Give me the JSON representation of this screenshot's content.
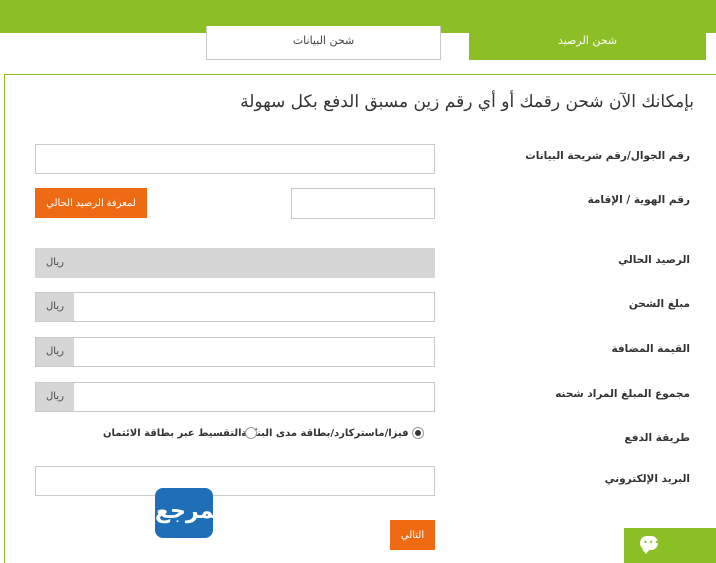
{
  "tabs": {
    "data_recharge": "شحن البيانات",
    "balance_recharge": "شحن الرصيد"
  },
  "headline": "بإمكانك الآن شحن رقمك أو أي رقم زين مسبق الدفع بكل سهولة",
  "form": {
    "mobile_label": "رقم الجوال/رقم شريحة البيانات",
    "mobile_value": "",
    "id_label": "رقم الهوية / الإقامة",
    "id_value": "",
    "check_balance_button": "لمعرفة الرصيد الحالي",
    "current_balance_label": "الرصيد الحالي",
    "amount_label": "مبلغ الشحن",
    "vat_label": "القيمة المضافة",
    "total_label": "مجموع المبلغ المراد شحنه",
    "currency": "ريال",
    "payment_label": "طريقة الدفع",
    "payment_options": [
      {
        "label": "فيزا/ماستركارد/بطاقة مدى البنكية",
        "selected": true
      },
      {
        "label": "التقسيط عبر بطاقة الائتمان",
        "selected": false
      }
    ],
    "email_label": "البريد الإلكتروني",
    "email_value": "",
    "next_button": "التالي"
  },
  "logo_text": "المرجع",
  "colors": {
    "brand_green": "#8cbf26",
    "accent_orange": "#ee6b14",
    "logo_blue": "#1f6fb8"
  }
}
